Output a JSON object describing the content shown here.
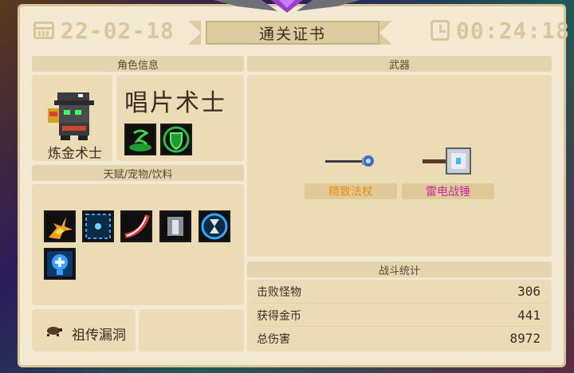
{
  "header": {
    "date": "22-02-18",
    "title": "通关证书",
    "time": "00:24:18"
  },
  "sections": {
    "character_info": "角色信息",
    "weapons": "武器",
    "talents_pets_drinks": "天赋/宠物/饮料",
    "battle_stats": "战斗统计"
  },
  "character": {
    "class_name": "炼金术士",
    "skin_name": "唱片术士",
    "skill_icons": [
      "green-vortex-skill-icon",
      "green-shield-skill-icon"
    ]
  },
  "weapons": [
    {
      "name": "精致法杖",
      "color": "#f08a12",
      "icon": "staff-icon"
    },
    {
      "name": "雷电战锤",
      "color": "#cc2aa8",
      "icon": "warhammer-icon"
    }
  ],
  "buffs": [
    {
      "icon": "explosion-buff-icon"
    },
    {
      "icon": "crosshair-buff-icon"
    },
    {
      "icon": "slash-buff-icon"
    },
    {
      "icon": "armor-buff-icon"
    },
    {
      "icon": "hourglass-buff-icon"
    },
    {
      "icon": "brain-buff-icon"
    }
  ],
  "pet": {
    "name": "祖传漏洞",
    "icon": "bug-pet-icon"
  },
  "stats": [
    {
      "label": "击败怪物",
      "value": "306"
    },
    {
      "label": "获得金币",
      "value": "441"
    },
    {
      "label": "总伤害",
      "value": "8972"
    }
  ],
  "colors": {
    "panel": "#f3e9d2",
    "header_text": "#d9c79b",
    "section_head": "#e4d5ad",
    "box": "#ebdcb6"
  }
}
